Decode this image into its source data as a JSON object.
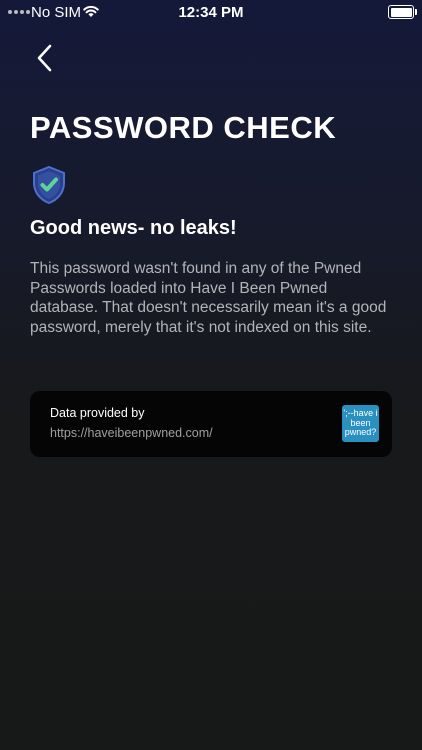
{
  "status_bar": {
    "carrier": "No SIM",
    "time": "12:34 PM"
  },
  "header": {
    "title": "PASSWORD CHECK"
  },
  "result": {
    "headline": "Good news- no leaks!",
    "description": "This password wasn't found in any of the Pwned Passwords loaded into Have I Been Pwned database. That doesn't necessarily mean it's a good password, merely that it's not indexed on this site."
  },
  "attribution": {
    "label": "Data provided by",
    "url": "https://haveibeenpwned.com/",
    "logo_text": "';--have i been pwned?"
  },
  "icons": {
    "back": "chevron-left-icon",
    "shield": "shield-check-icon",
    "wifi": "wifi-icon",
    "battery": "battery-icon"
  },
  "colors": {
    "shield_blue": "#3c64c8",
    "check_green": "#5ed49a",
    "logo_blue": "#2a90c0"
  }
}
